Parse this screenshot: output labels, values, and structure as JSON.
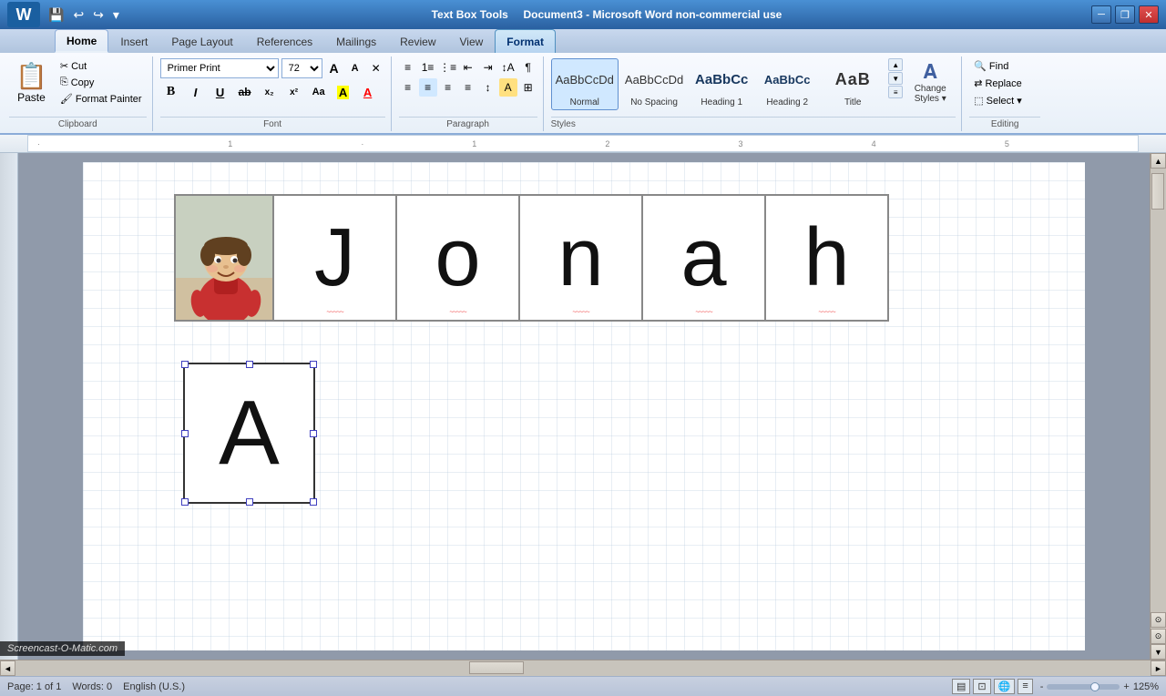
{
  "titlebar": {
    "title": "Document3 - Microsoft Word non-commercial use",
    "context_title": "Text Box Tools",
    "minimize": "─",
    "restore": "❐",
    "close": "✕"
  },
  "quickaccess": {
    "save": "💾",
    "undo": "↩",
    "redo": "↪",
    "more": "▾"
  },
  "tabs": [
    {
      "label": "Home",
      "active": true
    },
    {
      "label": "Insert"
    },
    {
      "label": "Page Layout"
    },
    {
      "label": "References"
    },
    {
      "label": "Mailings"
    },
    {
      "label": "Review"
    },
    {
      "label": "View"
    },
    {
      "label": "Format",
      "format": true
    }
  ],
  "ribbon": {
    "clipboard": {
      "label": "Clipboard",
      "paste": "Paste",
      "cut": "✂ Cut",
      "copy": "📋 Copy",
      "format_painter": "🖌 Format Painter"
    },
    "font": {
      "label": "Font",
      "font_name": "Primer Print",
      "font_size": "72",
      "grow": "A",
      "shrink": "A",
      "clear": "✕",
      "bold": "B",
      "italic": "I",
      "underline": "U",
      "strikethrough": "ab",
      "subscript": "x₂",
      "superscript": "x²",
      "case": "Aa",
      "highlight": "A",
      "color": "A"
    },
    "paragraph": {
      "label": "Paragraph"
    },
    "styles": {
      "label": "Styles",
      "items": [
        {
          "name": "Normal",
          "preview_type": "normal"
        },
        {
          "name": "No Spacing",
          "preview_type": "nospacing"
        },
        {
          "name": "Heading 1",
          "preview_type": "h1"
        },
        {
          "name": "Heading 2",
          "preview_type": "h2"
        },
        {
          "name": "Title",
          "preview_type": "title"
        }
      ],
      "change_styles": "Change\nStyles"
    },
    "editing": {
      "label": "Editing",
      "find": "Find",
      "replace": "Replace",
      "select": "Select ▾"
    }
  },
  "document": {
    "letters": [
      "J",
      "o",
      "n",
      "a",
      "h"
    ],
    "text_box_letter": "A"
  },
  "statusbar": {
    "page": "Page: 1 of 1",
    "words": "Words: 0",
    "language": "English (U.S.)",
    "zoom": "125%"
  },
  "watermark": "Screencast-O-Matic.com"
}
